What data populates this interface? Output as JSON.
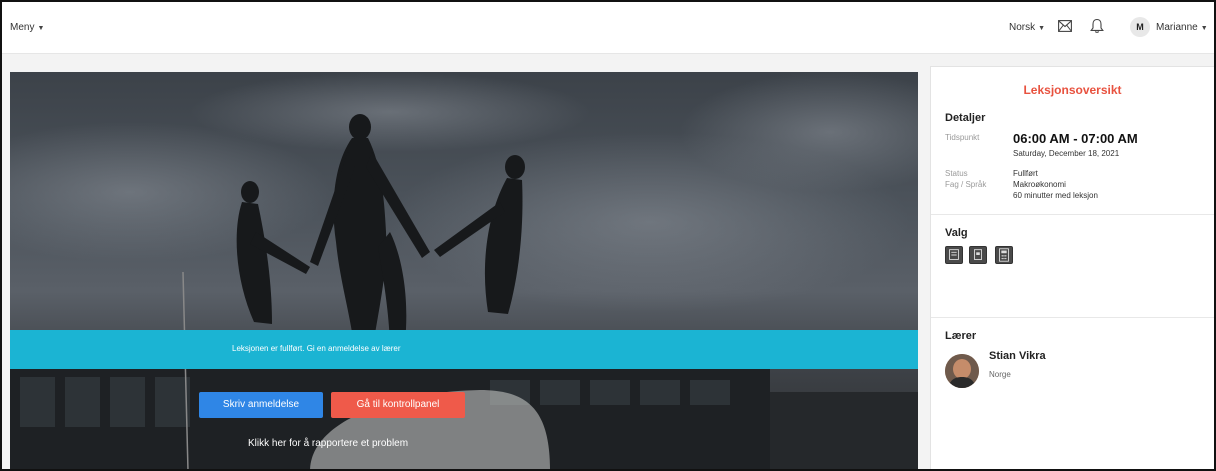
{
  "topbar": {
    "menu_label": "Meny",
    "language": "Norsk",
    "avatar_initial": "M",
    "user_name": "Marianne"
  },
  "hero": {
    "banner_text": "Leksjonen er fullført. Gi en anmeldelse av lærer",
    "review_button": "Skriv anmeldelse",
    "dashboard_button": "Gå til kontrollpanel",
    "report_link": "Klikk her for å rapportere et problem"
  },
  "panel": {
    "title": "Leksjonsoversikt",
    "details": {
      "heading": "Detaljer",
      "time_label": "Tidspunkt",
      "time_value": "06:00 AM - 07:00 AM",
      "date_value": "Saturday, December 18, 2021",
      "status_label": "Status",
      "status_value": "Fullført",
      "subject_label": "Fag / Språk",
      "subject_value": "Makroøkonomi",
      "duration_value": "60 minutter med leksjon"
    },
    "options": {
      "heading": "Valg",
      "icons": [
        "board-icon",
        "document-icon",
        "calculator-icon"
      ]
    },
    "teacher": {
      "heading": "Lærer",
      "name": "Stian Vikra",
      "country": "Norge"
    }
  },
  "colors": {
    "accent_red": "#e8523f",
    "banner_cyan": "#1bb4d3",
    "button_blue": "#2f86e6",
    "button_red": "#ef5a4a"
  }
}
